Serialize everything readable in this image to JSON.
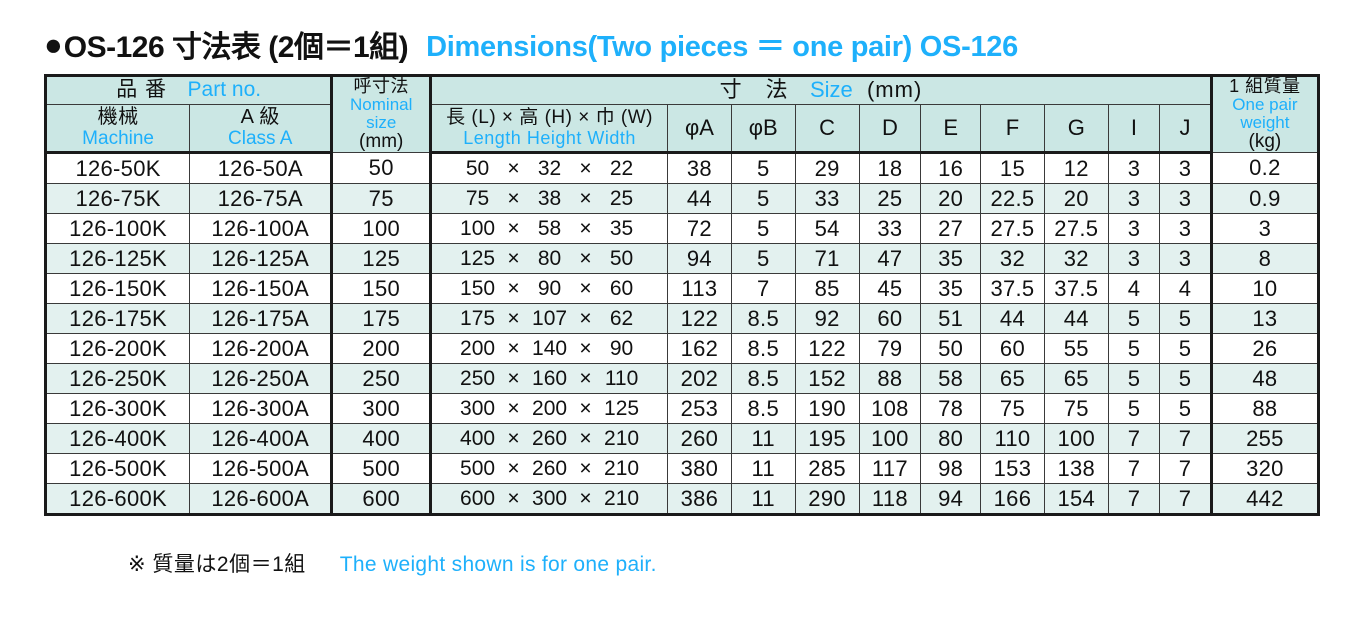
{
  "title": {
    "bullet": "●",
    "jp": "OS-126 寸法表 (2個＝1組)",
    "en": "Dimensions(Two pieces ＝ one pair) OS-126"
  },
  "table": {
    "header": {
      "part_no_jp": "品 番",
      "part_no_en": "Part no.",
      "machine_jp": "機械",
      "machine_en": "Machine",
      "class_a_jp": "A 級",
      "class_a_en": "Class A",
      "nominal_jp": "呼寸法",
      "nominal_en1": "Nominal",
      "nominal_en2": "size",
      "nominal_unit": "(mm)",
      "size_jp": "寸　法",
      "size_en": "Size",
      "size_unit": "(mm)",
      "lhw_jp": "長 (L) × 高 (H) × 巾 (W)",
      "lhw_en": "Length   Height   Width",
      "phi_a": "φA",
      "phi_b": "φB",
      "c": "C",
      "d": "D",
      "e": "E",
      "f": "F",
      "g": "G",
      "i": "I",
      "j": "J",
      "weight_jp": "1 組質量",
      "weight_en1": "One pair",
      "weight_en2": "weight",
      "weight_unit": "(kg)"
    },
    "rows": [
      {
        "machine": "126-50K",
        "class_a": "126-50A",
        "nominal": "50",
        "L": "50",
        "H": "32",
        "W": "22",
        "phiA": "38",
        "phiB": "5",
        "C": "29",
        "D": "18",
        "E": "16",
        "F": "15",
        "G": "12",
        "I": "3",
        "J": "3",
        "weight": "0.2"
      },
      {
        "machine": "126-75K",
        "class_a": "126-75A",
        "nominal": "75",
        "L": "75",
        "H": "38",
        "W": "25",
        "phiA": "44",
        "phiB": "5",
        "C": "33",
        "D": "25",
        "E": "20",
        "F": "22.5",
        "G": "20",
        "I": "3",
        "J": "3",
        "weight": "0.9"
      },
      {
        "machine": "126-100K",
        "class_a": "126-100A",
        "nominal": "100",
        "L": "100",
        "H": "58",
        "W": "35",
        "phiA": "72",
        "phiB": "5",
        "C": "54",
        "D": "33",
        "E": "27",
        "F": "27.5",
        "G": "27.5",
        "I": "3",
        "J": "3",
        "weight": "3"
      },
      {
        "machine": "126-125K",
        "class_a": "126-125A",
        "nominal": "125",
        "L": "125",
        "H": "80",
        "W": "50",
        "phiA": "94",
        "phiB": "5",
        "C": "71",
        "D": "47",
        "E": "35",
        "F": "32",
        "G": "32",
        "I": "3",
        "J": "3",
        "weight": "8"
      },
      {
        "machine": "126-150K",
        "class_a": "126-150A",
        "nominal": "150",
        "L": "150",
        "H": "90",
        "W": "60",
        "phiA": "113",
        "phiB": "7",
        "C": "85",
        "D": "45",
        "E": "35",
        "F": "37.5",
        "G": "37.5",
        "I": "4",
        "J": "4",
        "weight": "10"
      },
      {
        "machine": "126-175K",
        "class_a": "126-175A",
        "nominal": "175",
        "L": "175",
        "H": "107",
        "W": "62",
        "phiA": "122",
        "phiB": "8.5",
        "C": "92",
        "D": "60",
        "E": "51",
        "F": "44",
        "G": "44",
        "I": "5",
        "J": "5",
        "weight": "13"
      },
      {
        "machine": "126-200K",
        "class_a": "126-200A",
        "nominal": "200",
        "L": "200",
        "H": "140",
        "W": "90",
        "phiA": "162",
        "phiB": "8.5",
        "C": "122",
        "D": "79",
        "E": "50",
        "F": "60",
        "G": "55",
        "I": "5",
        "J": "5",
        "weight": "26"
      },
      {
        "machine": "126-250K",
        "class_a": "126-250A",
        "nominal": "250",
        "L": "250",
        "H": "160",
        "W": "110",
        "phiA": "202",
        "phiB": "8.5",
        "C": "152",
        "D": "88",
        "E": "58",
        "F": "65",
        "G": "65",
        "I": "5",
        "J": "5",
        "weight": "48"
      },
      {
        "machine": "126-300K",
        "class_a": "126-300A",
        "nominal": "300",
        "L": "300",
        "H": "200",
        "W": "125",
        "phiA": "253",
        "phiB": "8.5",
        "C": "190",
        "D": "108",
        "E": "78",
        "F": "75",
        "G": "75",
        "I": "5",
        "J": "5",
        "weight": "88"
      },
      {
        "machine": "126-400K",
        "class_a": "126-400A",
        "nominal": "400",
        "L": "400",
        "H": "260",
        "W": "210",
        "phiA": "260",
        "phiB": "11",
        "C": "195",
        "D": "100",
        "E": "80",
        "F": "110",
        "G": "100",
        "I": "7",
        "J": "7",
        "weight": "255"
      },
      {
        "machine": "126-500K",
        "class_a": "126-500A",
        "nominal": "500",
        "L": "500",
        "H": "260",
        "W": "210",
        "phiA": "380",
        "phiB": "11",
        "C": "285",
        "D": "117",
        "E": "98",
        "F": "153",
        "G": "138",
        "I": "7",
        "J": "7",
        "weight": "320"
      },
      {
        "machine": "126-600K",
        "class_a": "126-600A",
        "nominal": "600",
        "L": "600",
        "H": "300",
        "W": "210",
        "phiA": "386",
        "phiB": "11",
        "C": "290",
        "D": "118",
        "E": "94",
        "F": "166",
        "G": "154",
        "I": "7",
        "J": "7",
        "weight": "442"
      }
    ],
    "multiply_symbol": "×"
  },
  "note": {
    "jp": "※ 質量は2個＝1組",
    "en": "The weight shown is for one pair."
  },
  "colors": {
    "accent_blue": "#1eb0fb",
    "header_bg": "#cbe7e4",
    "row_alt_bg": "#e3f1ef",
    "text": "#111111",
    "border": "#1a1a1a"
  }
}
